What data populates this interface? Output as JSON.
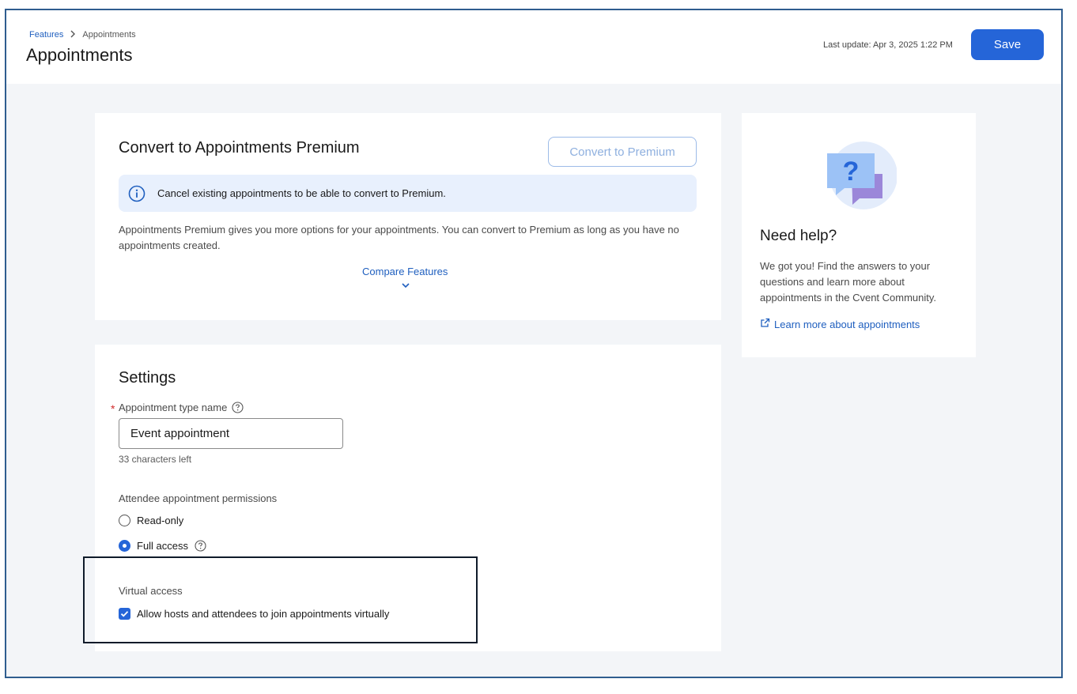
{
  "breadcrumb": {
    "parent": "Features",
    "separator": ">",
    "current": "Appointments"
  },
  "header": {
    "title": "Appointments",
    "last_update": "Last update: Apr 3, 2025 1:22 PM",
    "save_label": "Save"
  },
  "premium": {
    "title": "Convert to Appointments Premium",
    "convert_label": "Convert to Premium",
    "banner_text": "Cancel existing appointments to be able to convert to Premium.",
    "description": "Appointments Premium gives you more options for your appointments. You can convert to Premium as long as you have no appointments created.",
    "compare_label": "Compare Features"
  },
  "settings": {
    "title": "Settings",
    "required_marker": "*",
    "name_label": "Appointment type name",
    "name_value": "Event appointment",
    "char_count": "33 characters left",
    "permissions_label": "Attendee appointment permissions",
    "permissions_options": [
      {
        "label": "Read-only",
        "selected": false
      },
      {
        "label": "Full access",
        "selected": true
      }
    ],
    "virtual_label": "Virtual access",
    "virtual_checkbox_label": "Allow hosts and attendees to join appointments virtually",
    "virtual_checked": true
  },
  "help": {
    "title": "Need help?",
    "text": "We got you! Find the answers to your questions and learn more about appointments in the Cvent Community.",
    "link_label": "Learn more about appointments"
  },
  "colors": {
    "accent": "#2565d8",
    "link": "#1f5fbf",
    "banner_bg": "#e8f0fd",
    "page_bg": "#f3f5f8",
    "required": "#d12b2b"
  }
}
